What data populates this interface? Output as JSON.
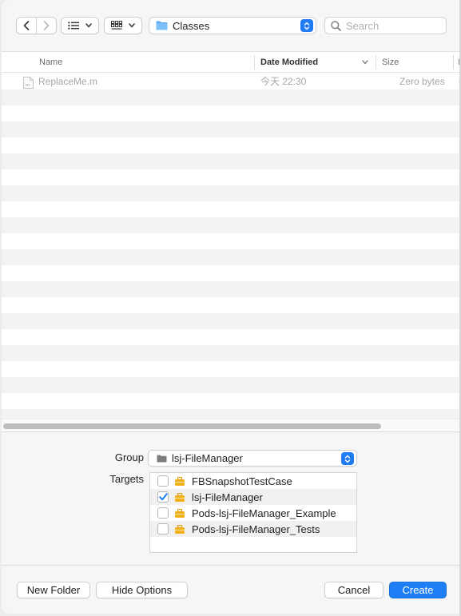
{
  "toolbar": {
    "path_label": "Classes",
    "search_placeholder": "Search"
  },
  "table": {
    "columns": [
      "Name",
      "Date Modified",
      "Size"
    ],
    "files": [
      {
        "name": "ReplaceMe.m",
        "date": "今天 22:30",
        "size": "Zero bytes"
      }
    ]
  },
  "options": {
    "group_label": "Group",
    "group_value": "lsj-FileManager",
    "targets_label": "Targets",
    "targets": [
      {
        "name": "FBSnapshotTestCase",
        "checked": false
      },
      {
        "name": "lsj-FileManager",
        "checked": true
      },
      {
        "name": "Pods-lsj-FileManager_Example",
        "checked": false
      },
      {
        "name": "Pods-lsj-FileManager_Tests",
        "checked": false
      }
    ]
  },
  "buttons": {
    "new_folder": "New Folder",
    "hide_options": "Hide Options",
    "cancel": "Cancel",
    "create": "Create"
  },
  "colors": {
    "accent": "#1d7ef5",
    "folder": "#4aa0f0",
    "target_icon": "#f6b31d"
  }
}
